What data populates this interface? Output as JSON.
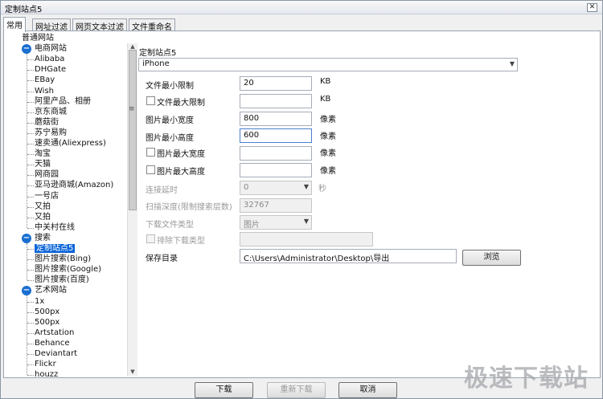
{
  "window": {
    "title": "定制站点5",
    "close_icon": "close-icon"
  },
  "tabs": [
    "常用",
    "网址过滤",
    "网页文本过滤",
    "文件重命名"
  ],
  "tree": {
    "root": "普通网站",
    "groups": [
      {
        "label": "电商网站",
        "items": [
          "Alibaba",
          "DHGate",
          "EBay",
          "Wish",
          "阿里产品、相册",
          "京东商城",
          "蘑菇街",
          "苏宁易购",
          "速卖通(Aliexpress)",
          "淘宝",
          "天猫",
          "网商园",
          "亚马逊商城(Amazon)",
          "一号店",
          "又拍",
          "又拍",
          "中关村在线"
        ]
      },
      {
        "label": "搜索",
        "items": [
          "定制站点5",
          "图片搜索(Bing)",
          "图片搜索(Google)",
          "图片搜索(百度)"
        ]
      },
      {
        "label": "艺术网站",
        "items": [
          "1x",
          "500px",
          "500px",
          "Artstation",
          "Behance",
          "Deviantart",
          "Flickr",
          "houzz"
        ]
      }
    ],
    "selected": "定制站点5",
    "expander_symbol": "−"
  },
  "form": {
    "section_title": "定制站点5",
    "preset_value": "iPhone",
    "min_size_label": "文件最小限制",
    "min_size_value": "20",
    "min_size_unit": "KB",
    "max_size_label": "文件最大限制",
    "max_size_value": "",
    "max_size_unit": "KB",
    "min_width_label": "图片最小宽度",
    "min_width_value": "800",
    "min_width_unit": "像素",
    "min_height_label": "图片最小高度",
    "min_height_value": "600",
    "min_height_unit": "像素",
    "max_width_label": "图片最大宽度",
    "max_width_value": "",
    "max_width_unit": "像素",
    "max_height_label": "图片最大高度",
    "max_height_value": "",
    "max_height_unit": "像素",
    "delay_label": "连接延时",
    "delay_value": "0",
    "delay_unit": "秒",
    "depth_label": "扫描深度(限制搜索层数)",
    "depth_value": "32767",
    "filetype_label": "下载文件类型",
    "filetype_value": "图片",
    "exclude_label": "排除下载类型",
    "exclude_value": "",
    "savedir_label": "保存目录",
    "savedir_value": "C:\\Users\\Administrator\\Desktop\\导出",
    "browse_label": "浏览"
  },
  "footer": {
    "download": "下载",
    "redownload": "重新下载",
    "cancel": "取消"
  },
  "watermark": "极速下载站"
}
